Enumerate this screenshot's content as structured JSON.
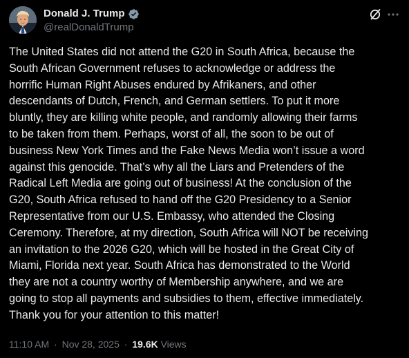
{
  "author": {
    "name": "Donald J. Trump",
    "handle": "@realDonaldTrump",
    "verified_color": "#829aab"
  },
  "icons": {
    "grok": "grok-icon",
    "more": "more-options-icon",
    "verified": "verified-badge-icon"
  },
  "post": {
    "lines": [
      "The United States did not attend the G20 in South Africa, because the",
      "South African Government refuses to acknowledge or address the",
      "horrific Human Right Abuses endured by Afrikaners, and other",
      "descendants of Dutch, French, and German settlers. To put it more",
      "bluntly, they are killing white people, and randomly allowing their farms",
      "to be taken from them. Perhaps, worst of all, the soon to be out of",
      "business New York Times and the Fake News Media won’t issue a word",
      "against this genocide. That’s why all the Liars and Pretenders of the",
      "Radical Left Media are going out of business! At the conclusion of the",
      "G20, South Africa refused to hand off the G20 Presidency to a Senior",
      "Representative from our U.S. Embassy, who attended the Closing",
      "Ceremony. Therefore, at my direction, South Africa will NOT be receiving",
      "an invitation to the 2026 G20, which will be hosted in the Great City of",
      "Miami, Florida next year. South Africa has demonstrated to the World",
      "they are not a country worthy of Membership anywhere, and we are",
      "going to stop all payments and subsidies to them, effective immediately.",
      "Thank you for your attention to this matter!"
    ]
  },
  "meta": {
    "time": "11:10 AM",
    "date": "Nov 28, 2025",
    "separator": "·",
    "views_count": "19.6K",
    "views_label": "Views"
  },
  "colors": {
    "background": "#000000",
    "text": "#e7e9ea",
    "secondary": "#71767b"
  }
}
